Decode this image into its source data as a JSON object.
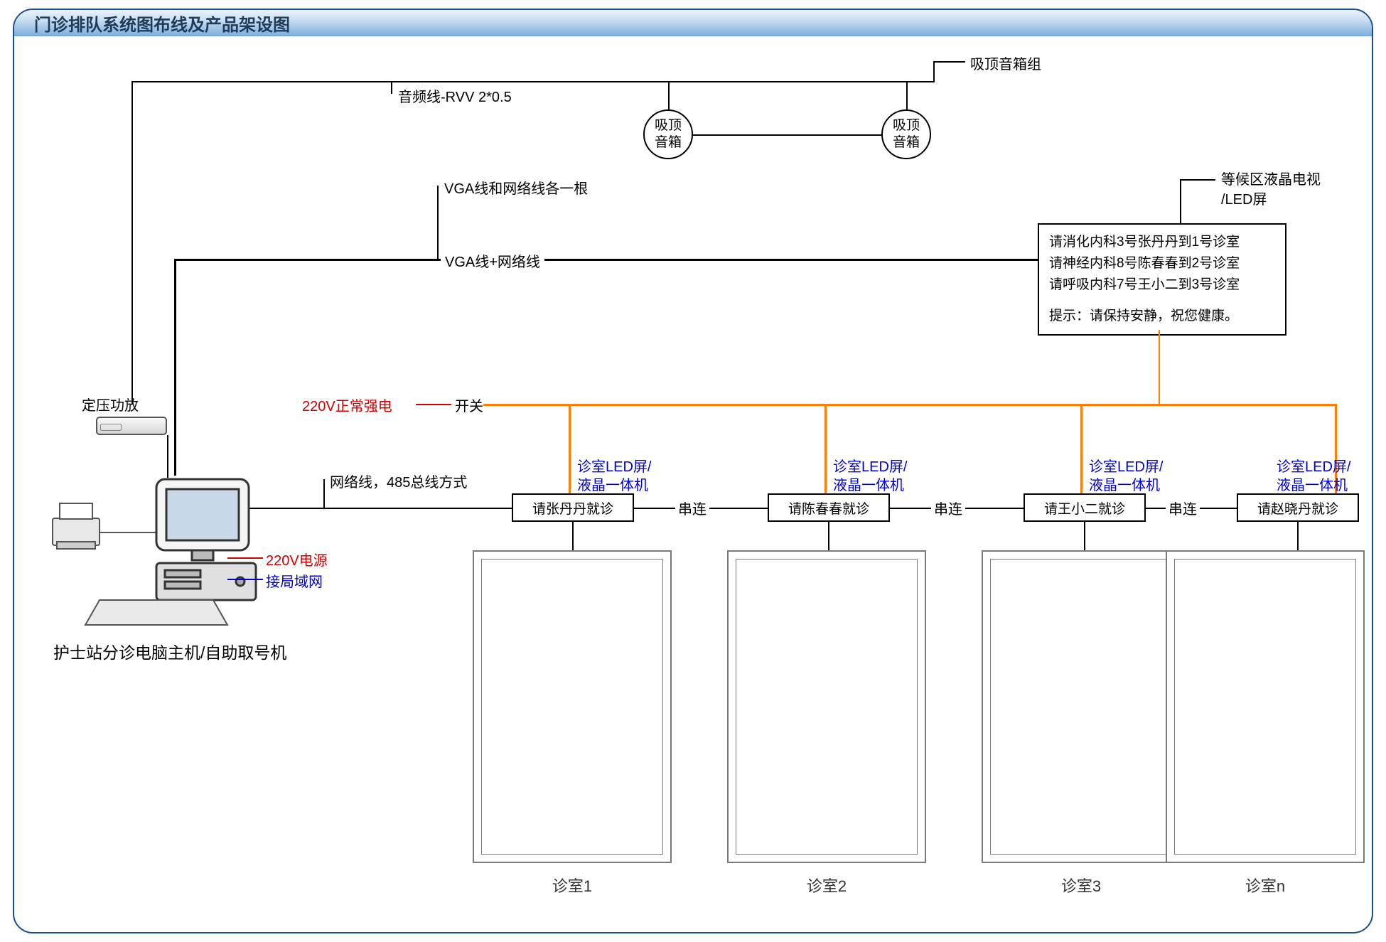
{
  "title": "门诊排队系统图布线及产品架设图",
  "labels": {
    "audio_cable": "音频线-RVV 2*0.5",
    "speaker": "吸顶\n音箱",
    "speaker_group": "吸顶音箱组",
    "vga_net_each": "VGA线和网络线各一根",
    "vga_plus_net": "VGA线+网络线",
    "tv_title": "等候区液晶电视\n/LED屏",
    "tv_line1": "请消化内科3号张丹丹到1号诊室",
    "tv_line2": "请神经内科8号陈春春到2号诊室",
    "tv_line3": "请呼吸内科7号王小二到3号诊室",
    "tv_tip": "提示：请保持安静，祝您健康。",
    "amplifier": "定压功放",
    "power_label": "220V正常强电",
    "switch": "开关",
    "net485": "网络线，485总线方式",
    "led_unit": "诊室LED屏/\n液晶一体机",
    "serial": "串连",
    "power_220": "220V电源",
    "lan": "接局域网",
    "nurse_station": "护士站分诊电脑主机/自助取号机"
  },
  "led_texts": [
    "请张丹丹就诊",
    "请陈春春就诊",
    "请王小二就诊",
    "请赵晓丹就诊"
  ],
  "rooms": [
    "诊室1",
    "诊室2",
    "诊室3",
    "诊室n"
  ]
}
